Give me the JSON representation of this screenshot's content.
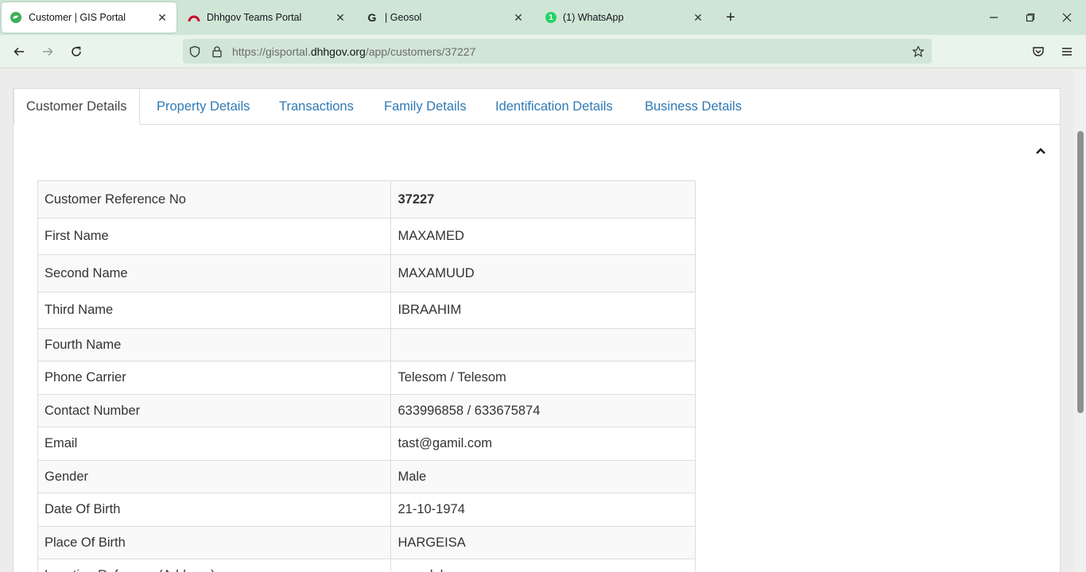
{
  "browser": {
    "tabs": [
      {
        "title": "Customer | GIS Portal",
        "active": true
      },
      {
        "title": "Dhhgov Teams Portal",
        "active": false
      },
      {
        "title": "| Geosol",
        "active": false
      },
      {
        "title": "(1) WhatsApp",
        "active": false
      }
    ],
    "close_glyph": "✕",
    "new_tab_glyph": "+",
    "url_prefix": "https://gisportal.",
    "url_domain": "dhhgov.org",
    "url_path": "/app/customers/37227",
    "whatsapp_badge": "1",
    "geosol_letter": "G"
  },
  "page": {
    "tabs": [
      {
        "label": "Customer Details",
        "active": true
      },
      {
        "label": "Property Details",
        "active": false
      },
      {
        "label": "Transactions",
        "active": false
      },
      {
        "label": "Family Details",
        "active": false
      },
      {
        "label": "Identification Details",
        "active": false
      },
      {
        "label": "Business Details",
        "active": false
      }
    ],
    "rows": [
      {
        "label": "Customer Reference No",
        "value": "37227"
      },
      {
        "label": "First Name",
        "value": "MAXAMED"
      },
      {
        "label": "Second Name",
        "value": "MAXAMUUD"
      },
      {
        "label": "Third Name",
        "value": "IBRAAHIM"
      },
      {
        "label": "Fourth Name",
        "value": ""
      },
      {
        "label": "Phone Carrier",
        "value": "Telesom / Telesom"
      },
      {
        "label": "Contact Number",
        "value": "633996858 / 633675874"
      },
      {
        "label": "Email",
        "value": "tast@gamil.com"
      },
      {
        "label": "Gender",
        "value": "Male"
      },
      {
        "label": "Date Of Birth",
        "value": "21-10-1974"
      },
      {
        "label": "Place Of Birth",
        "value": "HARGEISA"
      },
      {
        "label": "Location Reference(Address)",
        "value": "masalaha"
      }
    ]
  },
  "colors": {
    "tabbar_bg": "#cfe6d6",
    "link_blue": "#2f7ab5",
    "whatsapp_green": "#25d366",
    "teams_red": "#c8102e"
  }
}
